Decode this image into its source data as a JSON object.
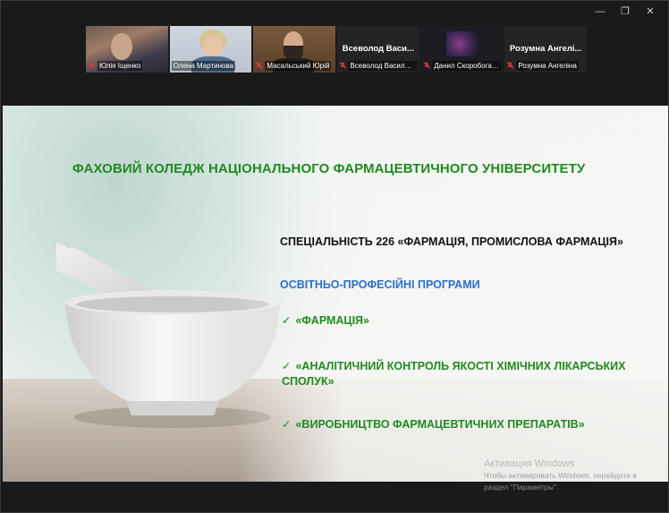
{
  "window": {
    "controls": {
      "minimize": "—",
      "restore": "❐",
      "close": "✕"
    }
  },
  "participants": [
    {
      "name": "Юлія Іщенко",
      "muted": true,
      "video": true,
      "active": false,
      "big_name": ""
    },
    {
      "name": "Олена Мартинова",
      "muted": false,
      "video": true,
      "active": true,
      "big_name": ""
    },
    {
      "name": "Масальський Юрій",
      "muted": true,
      "video": true,
      "active": false,
      "big_name": ""
    },
    {
      "name": "Всеволод Василенко",
      "muted": true,
      "video": false,
      "active": false,
      "big_name": "Всеволод Васи..."
    },
    {
      "name": "Данил Скоробогатов",
      "muted": true,
      "video": true,
      "active": false,
      "big_name": ""
    },
    {
      "name": "Розумна Ангеліна",
      "muted": true,
      "video": false,
      "active": false,
      "big_name": "Розумна Ангелі..."
    }
  ],
  "slide": {
    "title": "ФАХОВИЙ КОЛЕДЖ НАЦІОНАЛЬНОГО ФАРМАЦЕВТИЧНОГО УНІВЕРСИТЕТУ",
    "specialty": "СПЕЦІАЛЬНІСТЬ 226 «ФАРМАЦІЯ, ПРОМИСЛОВА ФАРМАЦІЯ»",
    "programs_heading": "ОСВІТНЬО-ПРОФЕСІЙНІ ПРОГРАМИ",
    "check_glyph": "✓",
    "programs": [
      "«ФАРМАЦІЯ»",
      "«АНАЛІТИЧНИЙ КОНТРОЛЬ ЯКОСТІ ХІМІЧНИХ ЛІКАРСЬКИХ СПОЛУК»",
      "«ВИРОБНИЦТВО ФАРМАЦЕВТИЧНИХ ПРЕПАРАТІВ»"
    ]
  },
  "watermark": {
    "title": "Активация Windows",
    "subtitle": "Чтобы активировать Windows, перейдите в раздел \"Параметры\"."
  },
  "colors": {
    "slide_green": "#1f8a1f",
    "slide_blue": "#2b6fc7",
    "active_speaker": "#2dbb5a",
    "muted_mic": "#e0393e"
  }
}
